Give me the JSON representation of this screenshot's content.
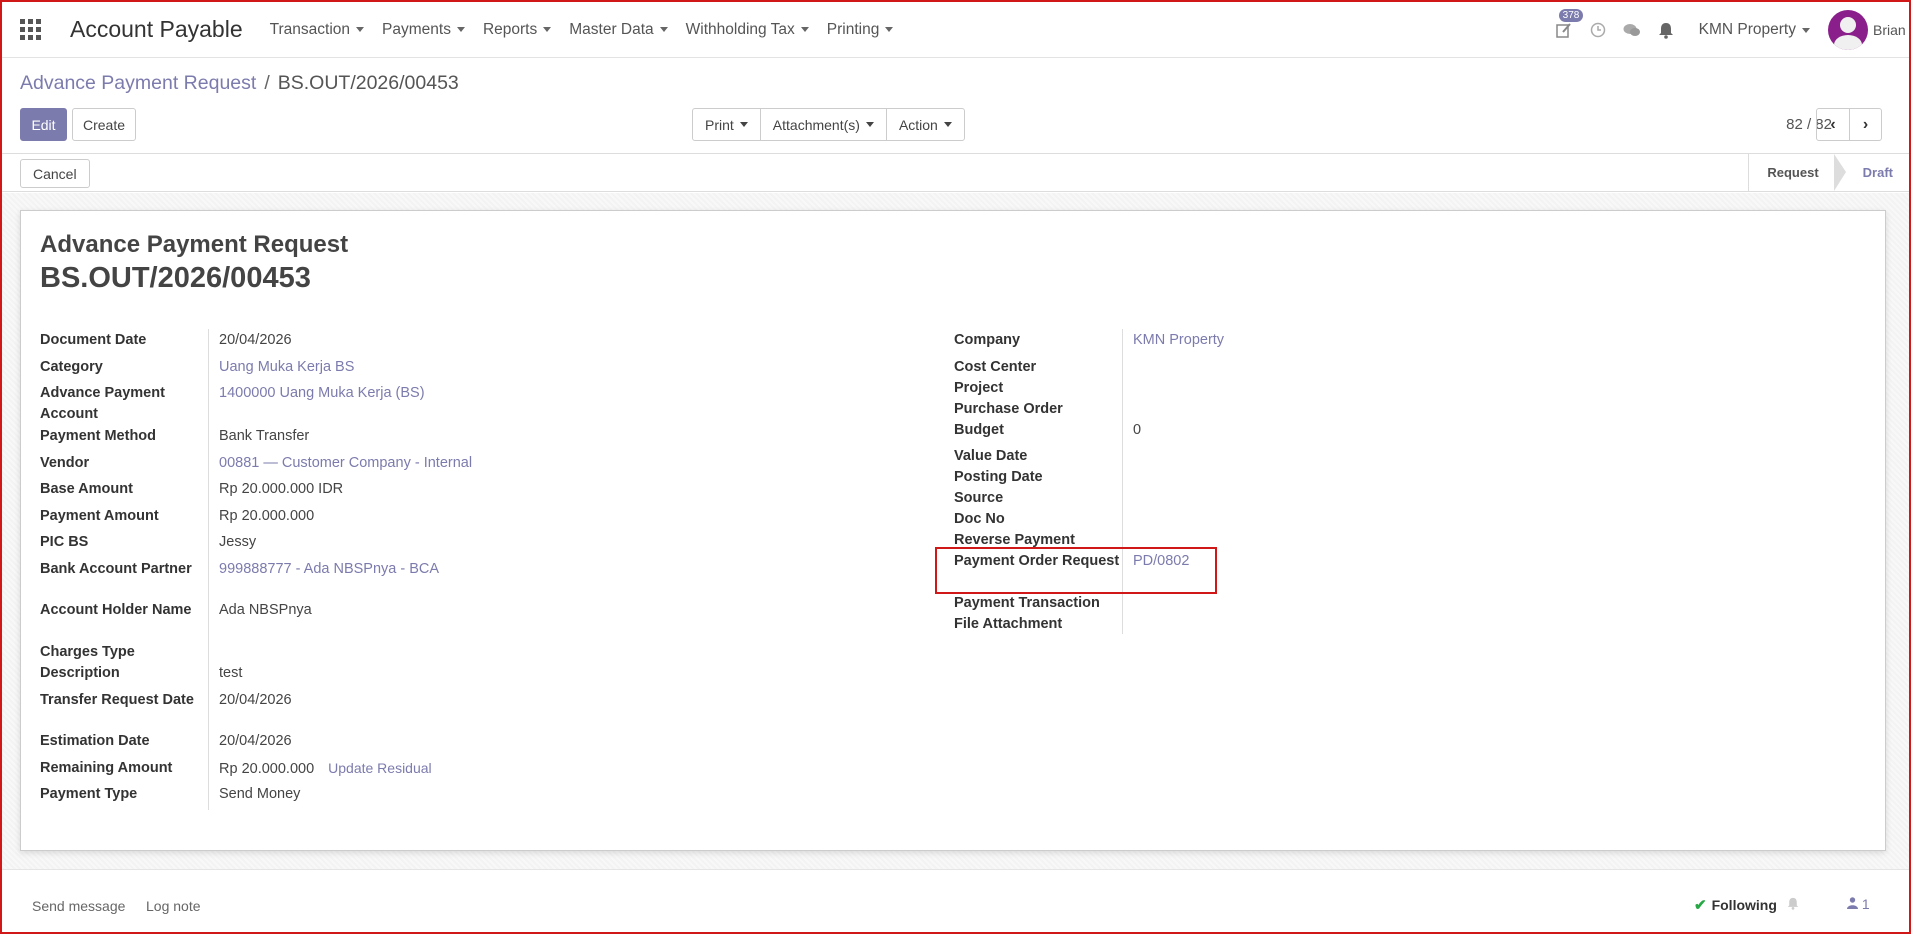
{
  "navbar": {
    "app_title": "Account Payable",
    "menu": [
      "Transaction",
      "Payments",
      "Reports",
      "Master Data",
      "Withholding Tax",
      "Printing"
    ],
    "activity_count": "378",
    "company": "KMN Property",
    "user": "Brian C"
  },
  "breadcrumb": {
    "parent": "Advance Payment Request",
    "separator": "/",
    "current": "BS.OUT/2026/00453"
  },
  "buttons": {
    "edit": "Edit",
    "create": "Create",
    "print": "Print",
    "attachments": "Attachment(s)",
    "action": "Action",
    "cancel": "Cancel"
  },
  "pager": {
    "value": "82 / 82",
    "prev": "‹",
    "next": "›"
  },
  "stages": [
    "Request",
    "Draft"
  ],
  "form": {
    "title": "Advance Payment Request",
    "name": "BS.OUT/2026/00453",
    "left_fields": [
      {
        "label": "Document Date",
        "value": "20/04/2026",
        "link": false
      },
      {
        "label": "Category",
        "value": "Uang Muka Kerja BS",
        "link": true
      },
      {
        "label": "Advance Payment Account",
        "value": "1400000 Uang Muka Kerja (BS)",
        "link": true
      },
      {
        "label": "Payment Method",
        "value": "Bank Transfer",
        "link": false
      },
      {
        "label": "Vendor",
        "value": "00881 — Customer Company - Internal",
        "link": true
      },
      {
        "label": "Base Amount",
        "value": "Rp 20.000.000  IDR",
        "link": false
      },
      {
        "label": "Payment Amount",
        "value": "Rp 20.000.000",
        "link": false
      },
      {
        "label": "PIC BS",
        "value": "Jessy",
        "link": false
      },
      {
        "label": "Bank Account Partner",
        "value": "999888777 - Ada NBSPnya - BCA",
        "link": true
      },
      {
        "label": "Account Holder Name",
        "value": "Ada NBSPnya",
        "link": false
      },
      {
        "label": "Charges Type",
        "value": "",
        "link": false
      },
      {
        "label": "Description",
        "value": "test",
        "link": false
      },
      {
        "label": "Transfer Request Date",
        "value": "20/04/2026",
        "link": false
      },
      {
        "label": "Estimation Date",
        "value": "20/04/2026",
        "link": false
      },
      {
        "label": "Remaining Amount",
        "value": "Rp 20.000.000",
        "link": false
      },
      {
        "label": "Payment Type",
        "value": "Send Money",
        "link": false
      }
    ],
    "update_residual": "Update Residual",
    "right_fields": [
      {
        "label": "Company",
        "value": "KMN Property",
        "link": true
      },
      {
        "label": "Cost Center",
        "value": "",
        "link": false
      },
      {
        "label": "Project",
        "value": "",
        "link": false
      },
      {
        "label": "Purchase Order",
        "value": "",
        "link": false
      },
      {
        "label": "Budget",
        "value": "0",
        "link": false
      },
      {
        "label": "Value Date",
        "value": "",
        "link": false
      },
      {
        "label": "Posting Date",
        "value": "",
        "link": false
      },
      {
        "label": "Source",
        "value": "",
        "link": false
      },
      {
        "label": "Doc No",
        "value": "",
        "link": false
      },
      {
        "label": "Reverse Payment",
        "value": "",
        "link": false
      },
      {
        "label": "Payment Order Request",
        "value": "PD/0802",
        "link": true
      },
      {
        "label": "Payment Transaction",
        "value": "",
        "link": false
      },
      {
        "label": "File Attachment",
        "value": "",
        "link": false
      }
    ]
  },
  "chatter": {
    "send_message": "Send message",
    "log_note": "Log note",
    "following": "Following",
    "followers": "1"
  },
  "colors": {
    "brand": "#7c7bad",
    "highlight": "#d01818"
  }
}
